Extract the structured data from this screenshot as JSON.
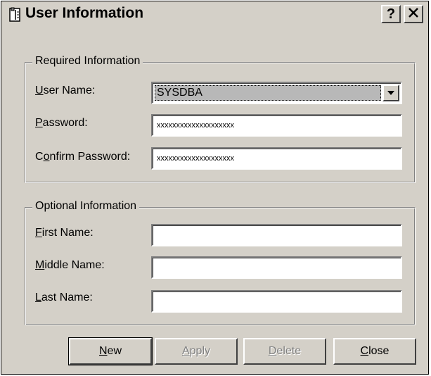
{
  "window": {
    "title": "User Information",
    "help_glyph": "?",
    "close_glyph": "✕"
  },
  "required": {
    "legend": "Required Information",
    "user_name": {
      "label_first": "U",
      "label_rest": "ser Name:",
      "value": "SYSDBA"
    },
    "password": {
      "label_first": "P",
      "label_rest": "assword:",
      "value": "xxxxxxxxxxxxxxxxxxxx"
    },
    "confirm_password": {
      "label_pre": "C",
      "label_first": "o",
      "label_rest": "nfirm Password:",
      "value": "xxxxxxxxxxxxxxxxxxxx"
    }
  },
  "optional": {
    "legend": "Optional Information",
    "first_name": {
      "label_first": "F",
      "label_rest": "irst Name:",
      "value": ""
    },
    "middle_name": {
      "label_first": "M",
      "label_rest": "iddle Name:",
      "value": ""
    },
    "last_name": {
      "label_first": "L",
      "label_rest": "ast Name:",
      "value": ""
    }
  },
  "buttons": {
    "new": {
      "first": "N",
      "rest": "ew"
    },
    "apply": {
      "first": "A",
      "rest": "pply"
    },
    "delete": {
      "first": "D",
      "rest": "elete"
    },
    "close": {
      "first": "C",
      "rest": "lose"
    }
  },
  "icons": {
    "title": "user-card-icon",
    "dropdown": "chevron-down-icon"
  },
  "colors": {
    "dialog_face": "#d4d0c8",
    "disabled_text": "#808080"
  }
}
